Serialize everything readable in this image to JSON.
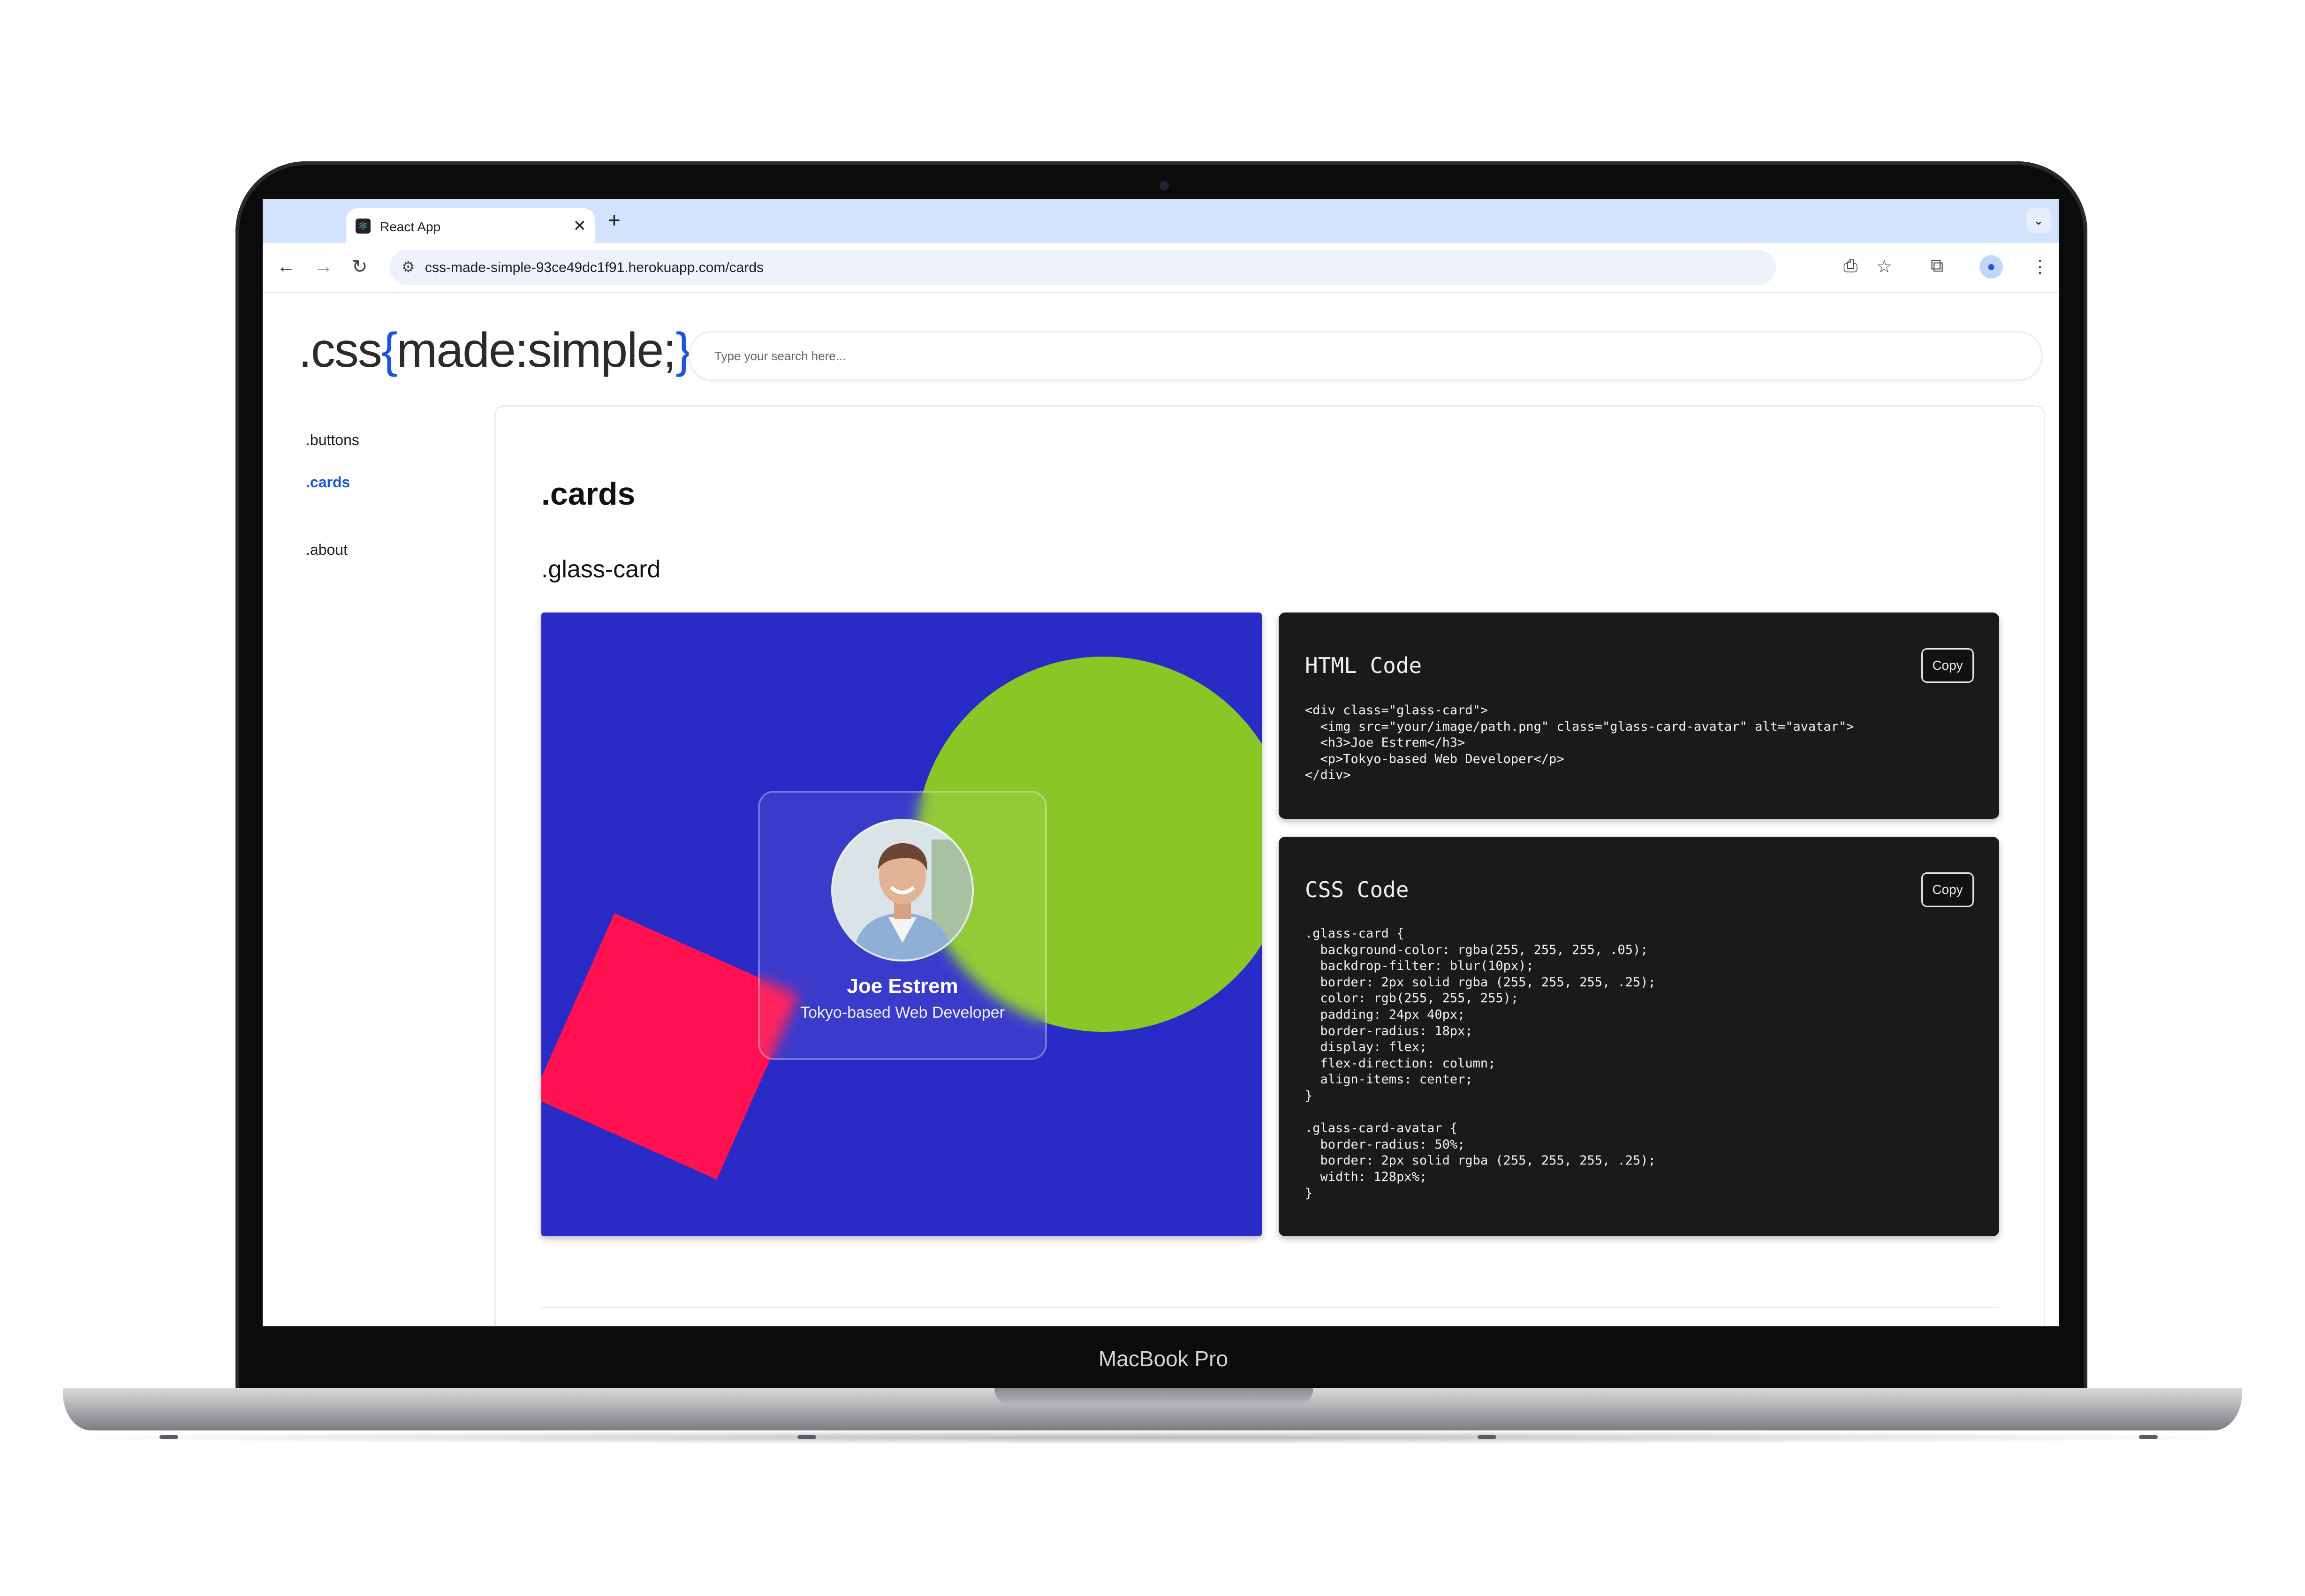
{
  "device_label": "MacBook Pro",
  "browser": {
    "tab_title": "React App",
    "tab_close": "✕",
    "new_tab": "+",
    "url": "css-made-simple-93ce49dc1f91.herokuapp.com/cards",
    "icons": [
      "back-arrow-icon",
      "forward-arrow-icon",
      "reload-icon",
      "site-settings-icon",
      "install-app-icon",
      "bookmark-star-icon",
      "extensions-icon",
      "profile-icon",
      "more-menu-icon",
      "tab-search-icon"
    ]
  },
  "site": {
    "logo_prefix": ".css",
    "logo_open_brace": "{",
    "logo_middle": "made:simple;",
    "logo_close_brace": "}",
    "search_placeholder": "Type your search here..."
  },
  "nav": {
    "items": [
      {
        "label": ".buttons",
        "active": false
      },
      {
        "label": ".cards",
        "active": true
      },
      {
        "label": ".about",
        "active": false
      }
    ]
  },
  "main": {
    "title": ".cards",
    "section": ".glass-card",
    "demo": {
      "name": "Joe Estrem",
      "role": "Tokyo-based Web Developer",
      "colors": {
        "background": "#2a2bc7",
        "circle": "#8ac626",
        "square": "#ff1151"
      }
    },
    "html_panel": {
      "heading": "HTML Code",
      "copy_label": "Copy",
      "code": "<div class=\"glass-card\">\n  <img src=\"your/image/path.png\" class=\"glass-card-avatar\" alt=\"avatar\">\n  <h3>Joe Estrem</h3>\n  <p>Tokyo-based Web Developer</p>\n</div>"
    },
    "css_panel": {
      "heading": "CSS Code",
      "copy_label": "Copy",
      "code": ".glass-card {\n  background-color: rgba(255, 255, 255, .05);\n  backdrop-filter: blur(10px);\n  border: 2px solid rgba (255, 255, 255, .25);\n  color: rgb(255, 255, 255);\n  padding: 24px 40px;\n  border-radius: 18px;\n  display: flex;\n  flex-direction: column;\n  align-items: center;\n}\n\n.glass-card-avatar {\n  border-radius: 50%;\n  border: 2px solid rgba (255, 255, 255, .25);\n  width: 128px%;\n}"
    }
  }
}
